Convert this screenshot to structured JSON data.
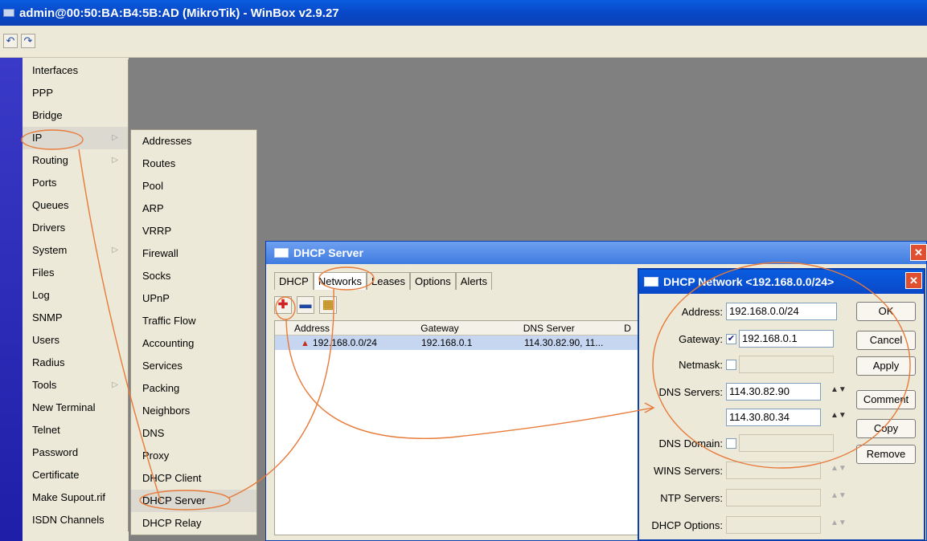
{
  "window": {
    "title": "admin@00:50:BA:B4:5B:AD (MikroTik) - WinBox v2.9.27"
  },
  "toolbar": {
    "undo_glyph": "↶",
    "redo_glyph": "↷"
  },
  "main_menu": [
    {
      "label": "Interfaces"
    },
    {
      "label": "PPP"
    },
    {
      "label": "Bridge"
    },
    {
      "label": "IP",
      "arrow": "▷"
    },
    {
      "label": "Routing",
      "arrow": "▷"
    },
    {
      "label": "Ports"
    },
    {
      "label": "Queues"
    },
    {
      "label": "Drivers"
    },
    {
      "label": "System",
      "arrow": "▷"
    },
    {
      "label": "Files"
    },
    {
      "label": "Log"
    },
    {
      "label": "SNMP"
    },
    {
      "label": "Users"
    },
    {
      "label": "Radius"
    },
    {
      "label": "Tools",
      "arrow": "▷"
    },
    {
      "label": "New Terminal"
    },
    {
      "label": "Telnet"
    },
    {
      "label": "Password"
    },
    {
      "label": "Certificate"
    },
    {
      "label": "Make Supout.rif"
    },
    {
      "label": "ISDN Channels"
    }
  ],
  "ip_submenu": [
    {
      "label": "Addresses"
    },
    {
      "label": "Routes"
    },
    {
      "label": "Pool"
    },
    {
      "label": "ARP"
    },
    {
      "label": "VRRP"
    },
    {
      "label": "Firewall"
    },
    {
      "label": "Socks"
    },
    {
      "label": "UPnP"
    },
    {
      "label": "Traffic Flow"
    },
    {
      "label": "Accounting"
    },
    {
      "label": "Services"
    },
    {
      "label": "Packing"
    },
    {
      "label": "Neighbors"
    },
    {
      "label": "DNS"
    },
    {
      "label": "Proxy"
    },
    {
      "label": "DHCP Client"
    },
    {
      "label": "DHCP Server"
    },
    {
      "label": "DHCP Relay"
    }
  ],
  "dhcp_server": {
    "title": "DHCP Server",
    "close_glyph": "✕",
    "tabs": [
      "DHCP",
      "Networks",
      "Leases",
      "Options",
      "Alerts"
    ],
    "add_glyph": "✚",
    "remove_glyph": "▬",
    "filter_glyph": "▦",
    "table": {
      "columns": [
        "Address",
        "Gateway",
        "DNS Server",
        "D"
      ],
      "rows": [
        {
          "address": "192.168.0.0/24",
          "gateway": "192.168.0.1",
          "dns": "114.30.82.90, 11..."
        }
      ]
    }
  },
  "dhcp_network": {
    "title": "DHCP Network <192.168.0.0/24>",
    "close_glyph": "✕",
    "address_label": "Address:",
    "address_value": "192.168.0.0/24",
    "gateway_label": "Gateway:",
    "gateway_value": "192.168.0.1",
    "netmask_label": "Netmask:",
    "dns_label": "DNS Servers:",
    "dns1_value": "114.30.82.90",
    "dns2_value": "114.30.80.34",
    "dns_domain_label": "DNS Domain:",
    "wins_label": "WINS Servers:",
    "ntp_label": "NTP Servers:",
    "dhcp_options_label": "DHCP Options:",
    "check_glyph": "✔",
    "spin_glyph": "▲▼",
    "buttons": {
      "ok": "OK",
      "cancel": "Cancel",
      "apply": "Apply",
      "comment": "Comment",
      "copy": "Copy",
      "remove": "Remove"
    }
  },
  "colors": {
    "annotation": "#e87a3a",
    "titlebar": "#0848c8"
  }
}
